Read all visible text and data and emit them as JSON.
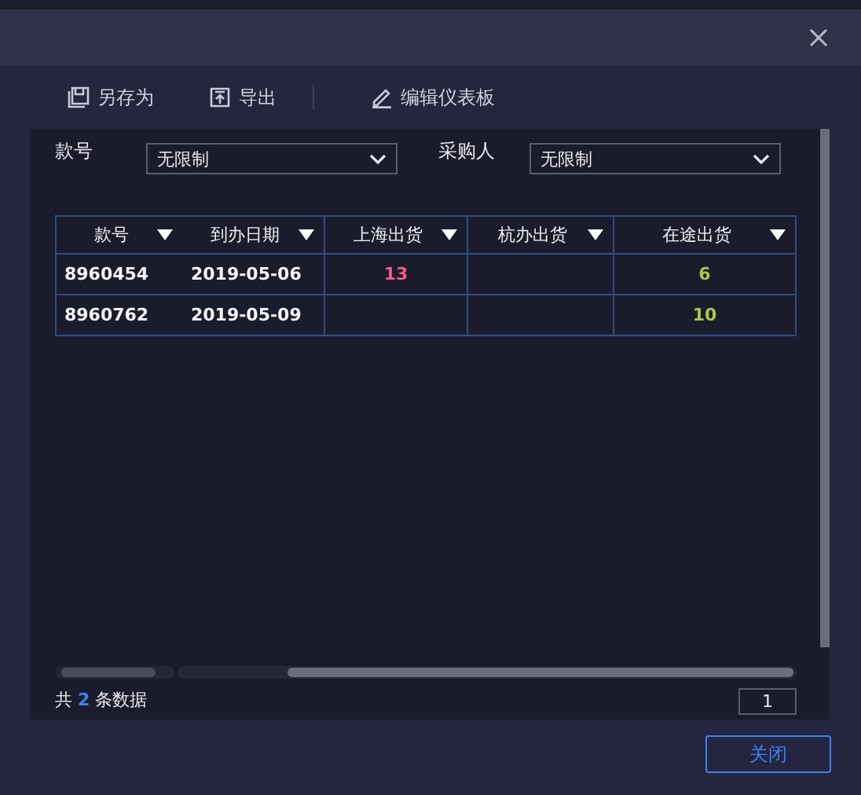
{
  "toolbar": [
    {
      "kind": "save",
      "label": "另存为"
    },
    {
      "kind": "export",
      "label": "导出"
    },
    {
      "kind": "edit",
      "label": "编辑仪表板"
    }
  ],
  "filters": [
    {
      "label": "款号",
      "value": "无限制"
    },
    {
      "label": "采购人",
      "value": "无限制"
    }
  ],
  "table": {
    "columns": [
      "款号",
      "到办日期",
      "上海出货",
      "杭办出货",
      "在途出货"
    ],
    "rows": [
      {
        "cells": [
          "8960454",
          "2019-05-06",
          "13",
          "",
          "6"
        ]
      },
      {
        "cells": [
          "8960762",
          "2019-05-09",
          "",
          "",
          "10"
        ]
      }
    ]
  },
  "footer": {
    "summary": "共 **2** 条数据",
    "page": "1"
  },
  "close_button": "关闭"
}
